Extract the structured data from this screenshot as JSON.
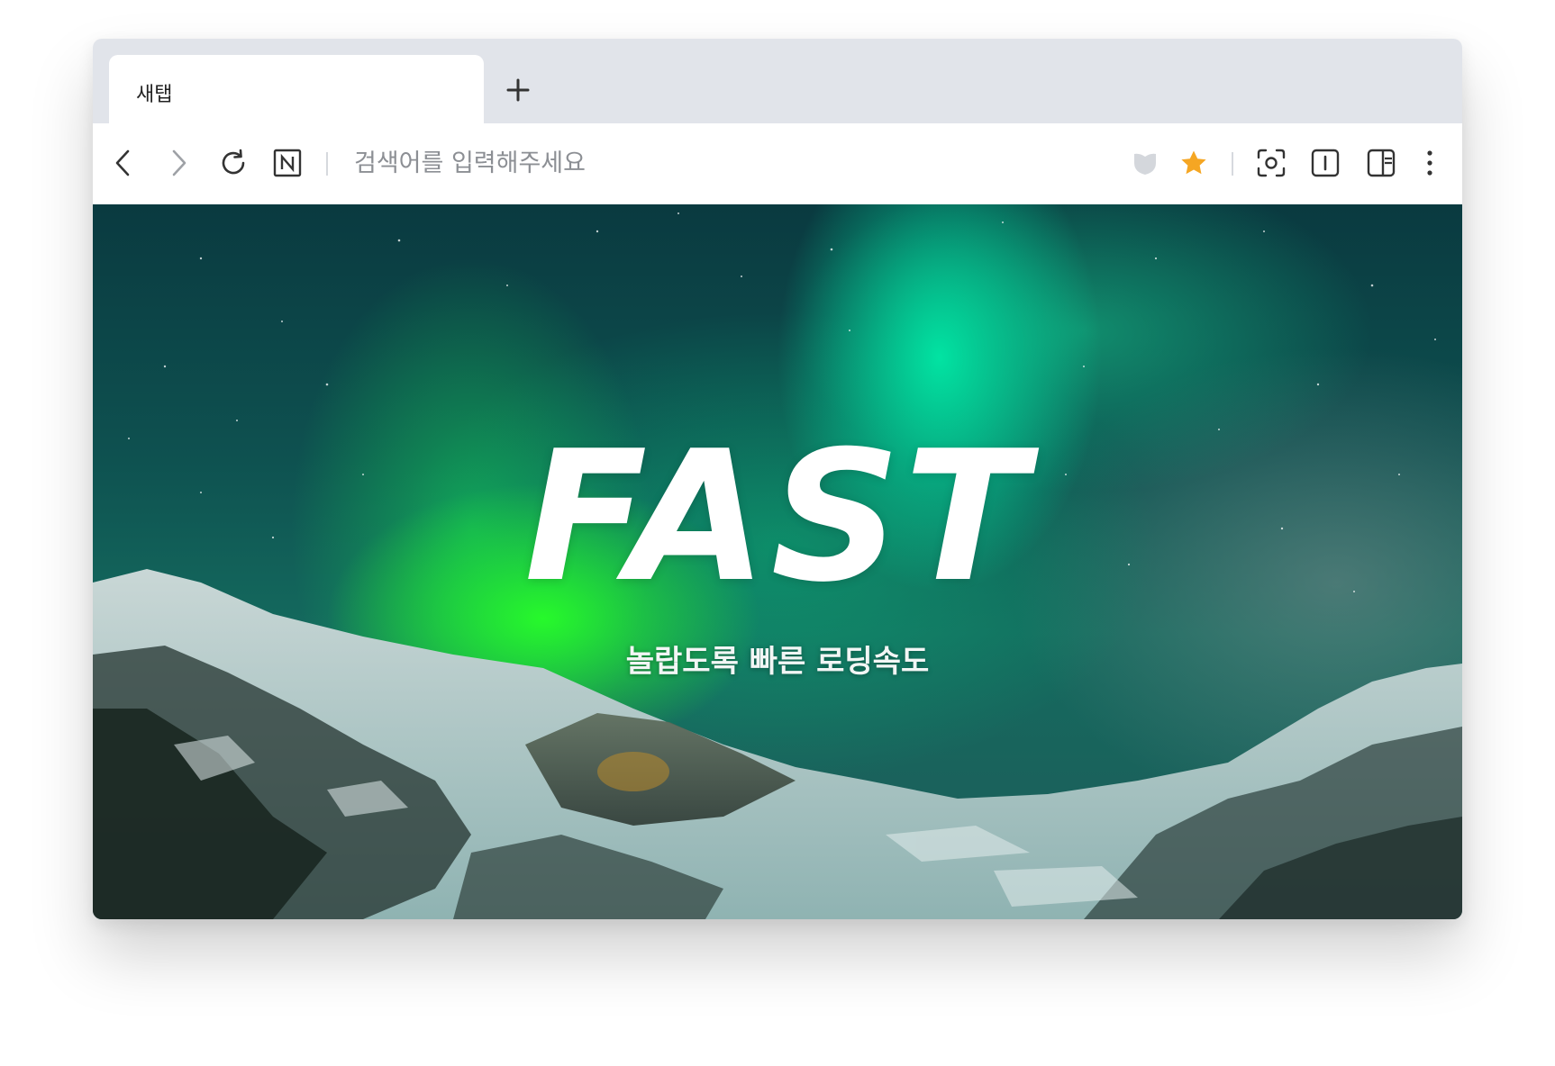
{
  "tabs": [
    {
      "title": "새탭",
      "active": true
    }
  ],
  "new_tab": {
    "icon": "plus-icon"
  },
  "toolbar": {
    "back": {
      "icon": "chevron-left-icon"
    },
    "forward": {
      "icon": "chevron-right-icon"
    },
    "reload": {
      "icon": "reload-icon"
    },
    "home": {
      "icon": "naver-n-icon",
      "label": "N"
    },
    "address": {
      "value": "",
      "placeholder": "검색어를 입력해주세요"
    },
    "shield": {
      "icon": "shield-icon"
    },
    "bookmark": {
      "icon": "star-icon",
      "color": "#f5a623"
    },
    "capture": {
      "icon": "capture-icon"
    },
    "reader": {
      "icon": "reader-mode-icon"
    },
    "sidebar": {
      "icon": "side-panel-icon"
    },
    "menu": {
      "icon": "more-vertical-icon"
    }
  },
  "hero": {
    "title": "FAST",
    "subtitle": "놀랍도록 빠른 로딩속도"
  }
}
